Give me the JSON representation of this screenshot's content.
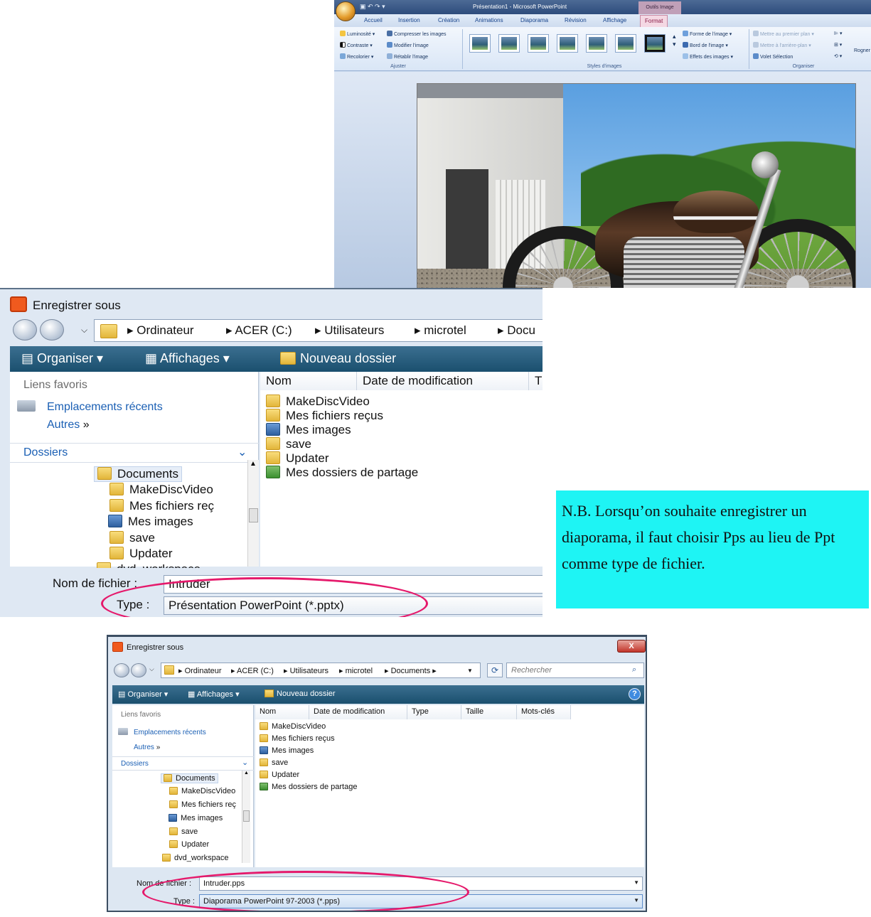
{
  "ppt": {
    "window_title": "Présentation1 - Microsoft PowerPoint",
    "contextual_tab": "Outils Image",
    "tabs": [
      "Accueil",
      "Insertion",
      "Création",
      "Animations",
      "Diaporama",
      "Révision",
      "Affichage",
      "Format"
    ],
    "active_tab": "Format",
    "ajuster": {
      "label": "Ajuster",
      "items": [
        "Luminosité",
        "Contraste",
        "Recolorier",
        "Compresser les images",
        "Modifier l'image",
        "Rétablir l'image"
      ]
    },
    "styles": {
      "label": "Styles d'images"
    },
    "styles_side": [
      "Forme de l'image",
      "Bord de l'image",
      "Effets des images"
    ],
    "organiser": {
      "label": "Organiser",
      "items": [
        "Mettre au premier plan",
        "Mettre à l'arrière-plan",
        "Volet Sélection"
      ]
    },
    "extra": "Rogner"
  },
  "dialog1": {
    "title": "Enregistrer sous",
    "breadcrumb": [
      "Ordinateur",
      "ACER (C:)",
      "Utilisateurs",
      "microtel",
      "Docu"
    ],
    "toolbar": {
      "organiser": "Organiser",
      "affichages": "Affichages",
      "nouveau_dossier": "Nouveau dossier"
    },
    "favorites_header": "Liens favoris",
    "favorites": [
      "Emplacements récents",
      "Autres"
    ],
    "folders_header": "Dossiers",
    "tree": [
      "Documents",
      "MakeDiscVideo",
      "Mes fichiers reç",
      "Mes images",
      "save",
      "Updater",
      "dvd_workspace"
    ],
    "columns": [
      "Nom",
      "Date de modification",
      "T"
    ],
    "files": [
      "MakeDiscVideo",
      "Mes fichiers reçus",
      "Mes images",
      "save",
      "Updater",
      "Mes dossiers de partage"
    ],
    "filename_label": "Nom de fichier :",
    "filename_value": "Intruder",
    "type_label": "Type :",
    "type_value": "Présentation PowerPoint (*.pptx)"
  },
  "note": {
    "text": "N.B. Lorsqu’on souhaite enregistrer  un diaporama, il faut choisir Pps au lieu de Ppt  comme type de fichier.",
    "bg_color": "#1ef4f4"
  },
  "dialog2": {
    "title": "Enregistrer sous",
    "close": "X",
    "breadcrumb": [
      "Ordinateur",
      "ACER (C:)",
      "Utilisateurs",
      "microtel",
      "Documents"
    ],
    "search_placeholder": "Rechercher",
    "toolbar": {
      "organiser": "Organiser",
      "affichages": "Affichages",
      "nouveau_dossier": "Nouveau dossier"
    },
    "favorites_header": "Liens favoris",
    "favorites": [
      "Emplacements récents",
      "Autres"
    ],
    "folders_header": "Dossiers",
    "tree": [
      "Documents",
      "MakeDiscVideo",
      "Mes fichiers reç",
      "Mes images",
      "save",
      "Updater",
      "dvd_workspace"
    ],
    "columns": [
      "Nom",
      "Date de modification",
      "Type",
      "Taille",
      "Mots-clés"
    ],
    "files": [
      "MakeDiscVideo",
      "Mes fichiers reçus",
      "Mes images",
      "save",
      "Updater",
      "Mes dossiers de partage"
    ],
    "filename_label": "Nom de fichier :",
    "filename_value": "Intruder.pps",
    "type_label": "Type :",
    "type_value": "Diaporama PowerPoint 97-2003 (*.pps)"
  },
  "colors": {
    "highlight_ellipse": "#e5196b",
    "toolbar": "#1a4f6e"
  }
}
